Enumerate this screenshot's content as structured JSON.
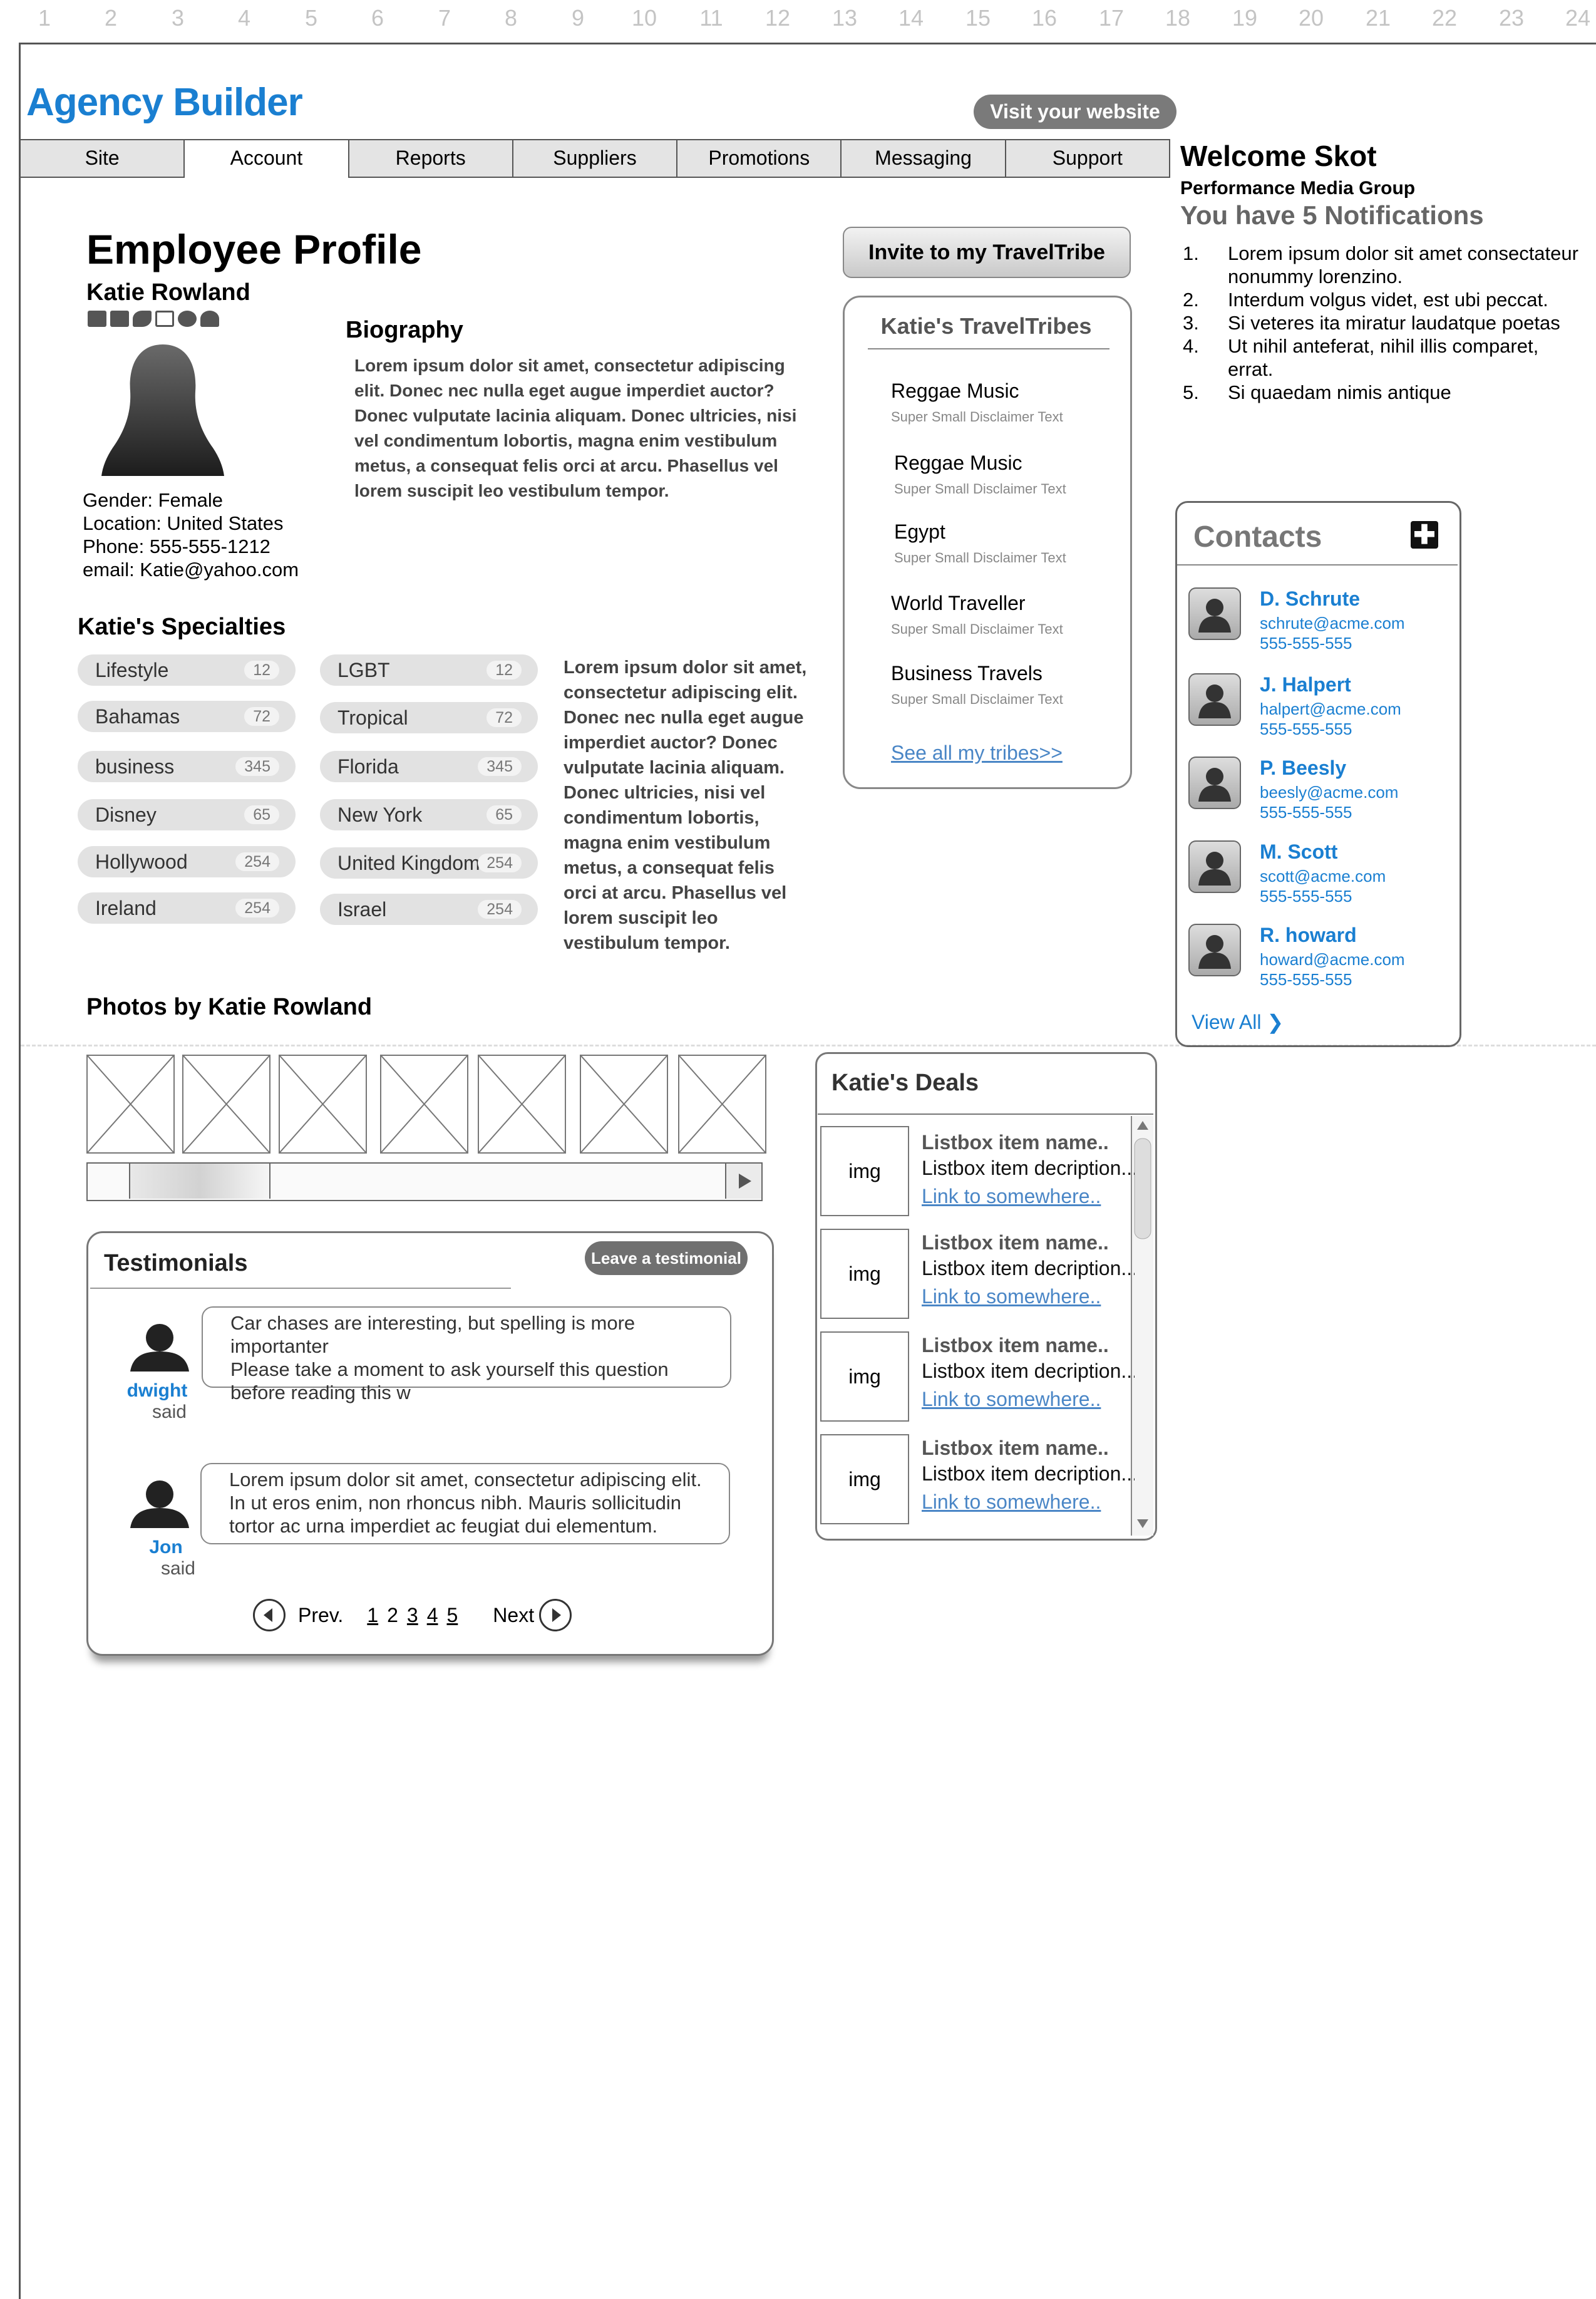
{
  "ruler": [
    "1",
    "2",
    "3",
    "4",
    "5",
    "6",
    "7",
    "8",
    "9",
    "10",
    "11",
    "12",
    "13",
    "14",
    "15",
    "16",
    "17",
    "18",
    "19",
    "20",
    "21",
    "22",
    "23",
    "24"
  ],
  "header": {
    "logo": "Agency Builder",
    "visit_button": "Visit your website",
    "tabs": [
      "Site",
      "Account",
      "Reports",
      "Suppliers",
      "Promotions",
      "Messaging",
      "Support"
    ],
    "active_tab": "Account"
  },
  "welcome": {
    "title": "Welcome Skot",
    "company": "Performance Media Group",
    "notifications_title": "You have 5 Notifications",
    "notifications": [
      {
        "num": "1.",
        "text": "Lorem ipsum dolor sit amet consectateur nonummy lorenzino."
      },
      {
        "num": "2.",
        "text": "Interdum volgus videt, est ubi peccat."
      },
      {
        "num": "3.",
        "text": "Si veteres ita miratur laudatque poetas"
      },
      {
        "num": "4.",
        "text": "Ut nihil anteferat, nihil illis comparet, errat."
      },
      {
        "num": "5.",
        "text": "Si quaedam nimis antique"
      }
    ]
  },
  "profile": {
    "page_title": "Employee Profile",
    "name": "Katie Rowland",
    "details": [
      "Gender: Female",
      "Location: United States",
      "Phone: 555-555-1212",
      "email: Katie@yahoo.com"
    ],
    "biography_title": "Biography",
    "biography": "Lorem ipsum dolor sit amet, consectetur adipiscing elit. Donec nec nulla eget augue imperdiet auctor? Donec vulputate lacinia aliquam. Donec ultricies, nisi vel condimentum lobortis, magna enim vestibulum metus, a consequat felis orci at arcu. Phasellus vel lorem suscipit leo vestibulum tempor."
  },
  "specialties": {
    "title": "Katie's Specialties",
    "left": [
      {
        "label": "Lifestyle",
        "count": "12"
      },
      {
        "label": "Bahamas",
        "count": "72"
      },
      {
        "label": "business",
        "count": "345"
      },
      {
        "label": "Disney",
        "count": "65"
      },
      {
        "label": "Hollywood",
        "count": "254"
      },
      {
        "label": "Ireland",
        "count": "254"
      }
    ],
    "right": [
      {
        "label": "LGBT",
        "count": "12"
      },
      {
        "label": "Tropical",
        "count": "72"
      },
      {
        "label": "Florida",
        "count": "345"
      },
      {
        "label": "New York",
        "count": "65"
      },
      {
        "label": "United Kingdom",
        "count": "254"
      },
      {
        "label": "Israel",
        "count": "254"
      }
    ],
    "text": "Lorem ipsum dolor sit amet, consectetur adipiscing elit. Donec nec nulla eget augue imperdiet auctor? Donec vulputate lacinia aliquam. Donec ultricies, nisi vel condimentum lobortis, magna enim vestibulum metus, a consequat felis orci at arcu. Phasellus vel lorem suscipit leo vestibulum tempor."
  },
  "tribes": {
    "invite_button": "Invite to my TravelTribe",
    "title": "Katie's TravelTribes",
    "items": [
      {
        "name": "Reggae Music",
        "sub": "Super Small Disclaimer Text"
      },
      {
        "name": "Reggae Music",
        "sub": "Super Small Disclaimer Text"
      },
      {
        "name": "Egypt",
        "sub": "Super Small Disclaimer Text"
      },
      {
        "name": "World Traveller",
        "sub": "Super Small Disclaimer Text"
      },
      {
        "name": "Business Travels",
        "sub": "Super Small Disclaimer Text"
      }
    ],
    "see_all": "See all my tribes>>"
  },
  "contacts": {
    "title": "Contacts",
    "add_symbol": "✚",
    "items": [
      {
        "name": "D. Schrute",
        "email": "schrute@acme.com",
        "phone": "555-555-555"
      },
      {
        "name": "J. Halpert",
        "email": "halpert@acme.com",
        "phone": "555-555-555"
      },
      {
        "name": "P. Beesly",
        "email": "beesly@acme.com",
        "phone": "555-555-555"
      },
      {
        "name": "M. Scott",
        "email": "scott@acme.com",
        "phone": "555-555-555"
      },
      {
        "name": "R. howard",
        "email": "howard@acme.com",
        "phone": "555-555-555"
      }
    ],
    "view_all": "View All ❯"
  },
  "photos": {
    "title": "Photos by Katie Rowland"
  },
  "testimonials": {
    "title": "Testimonials",
    "leave_button": "Leave a testimonial",
    "items": [
      {
        "author": "dwight",
        "said": "said",
        "text": "Car chases are interesting, but spelling is more importanter\nPlease take a moment to ask yourself this question before reading this w"
      },
      {
        "author": "Jon",
        "said": "said",
        "text": "Lorem ipsum dolor sit amet, consectetur adipiscing elit. In ut eros enim, non rhoncus nibh. Mauris sollicitudin tortor ac urna imperdiet ac feugiat dui elementum."
      }
    ],
    "pager": {
      "prev": "Prev.",
      "pages": [
        "1",
        "2",
        "3",
        "4",
        "5"
      ],
      "next": "Next"
    }
  },
  "deals": {
    "title": "Katie's Deals",
    "items": [
      {
        "img": "img",
        "name": "Listbox item name..",
        "desc": "Listbox item decription...",
        "link": "Link to somewhere.."
      },
      {
        "img": "img",
        "name": "Listbox item name..",
        "desc": "Listbox item decription...",
        "link": "Link to somewhere.."
      },
      {
        "img": "img",
        "name": "Listbox item name..",
        "desc": "Listbox item decription...",
        "link": "Link to somewhere.."
      },
      {
        "img": "img",
        "name": "Listbox item name..",
        "desc": "Listbox item decription...",
        "link": "Link to somewhere.."
      }
    ]
  }
}
